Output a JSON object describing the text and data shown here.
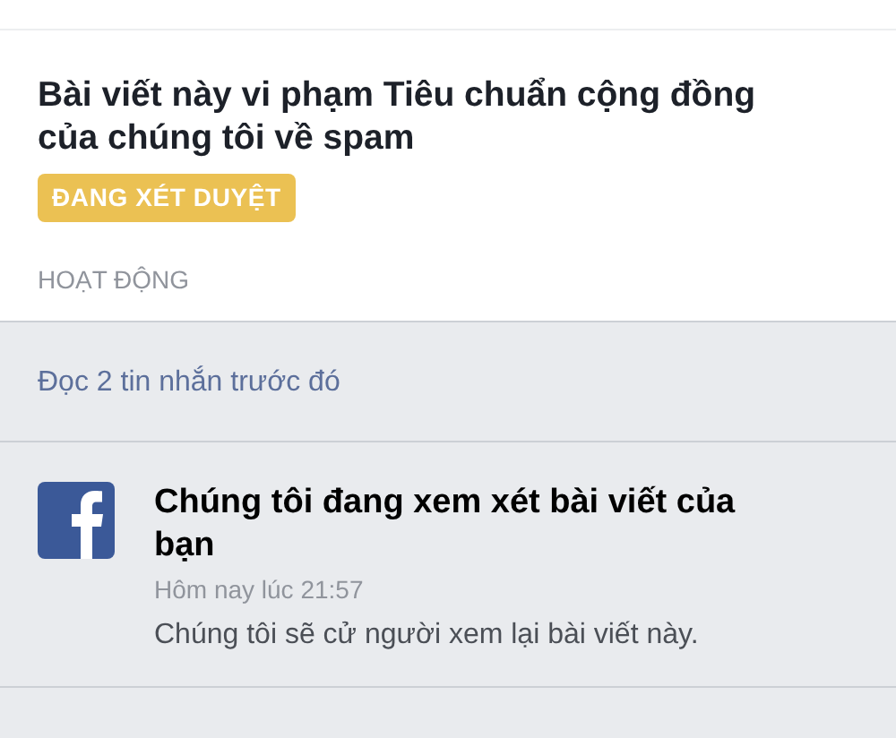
{
  "report": {
    "title": "Bài viết này vi phạm Tiêu chuẩn cộng đồng của chúng tôi về spam",
    "status": "ĐANG XÉT DUYỆT",
    "section_label": "HOẠT ĐỘNG"
  },
  "earlier_messages_link": "Đọc 2 tin nhắn trước đó",
  "messages": [
    {
      "title": "Chúng tôi đang xem xét bài viết của bạn",
      "time": "Hôm nay lúc 21:57",
      "body": "Chúng tôi sẽ cử người xem lại bài viết này."
    }
  ]
}
